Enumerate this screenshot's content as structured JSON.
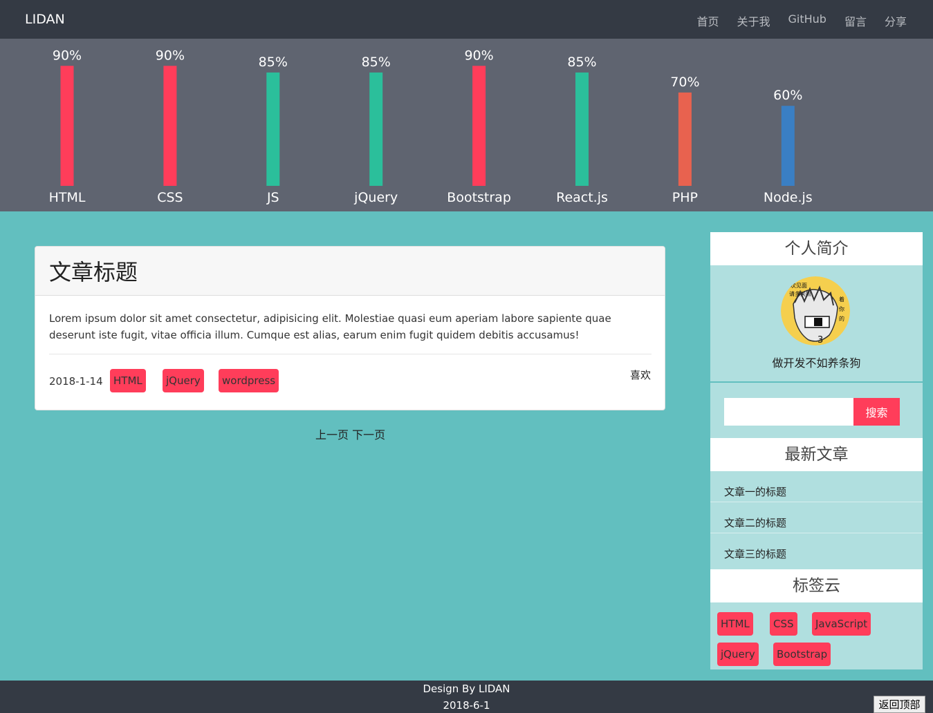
{
  "navbar": {
    "brand": "LIDAN",
    "links": [
      "首页",
      "关于我",
      "GitHub",
      "留言",
      "分享"
    ]
  },
  "colors": {
    "pink": "#ff3d5a",
    "green": "#2bbf9b",
    "orange": "#e8624f",
    "blue": "#3a7fc4",
    "teal_bg": "#62bfbf",
    "dark": "#343a44"
  },
  "chart_data": {
    "type": "bar",
    "categories": [
      "HTML",
      "CSS",
      "JS",
      "jQuery",
      "Bootstrap",
      "React.js",
      "PHP",
      "Node.js"
    ],
    "values": [
      90,
      90,
      85,
      85,
      90,
      85,
      70,
      60
    ],
    "labels": [
      "90%",
      "90%",
      "85%",
      "85%",
      "90%",
      "85%",
      "70%",
      "60%"
    ],
    "bar_colors": [
      "#ff3d5a",
      "#ff3d5a",
      "#2bbf9b",
      "#2bbf9b",
      "#ff3d5a",
      "#2bbf9b",
      "#e8624f",
      "#3a7fc4"
    ],
    "ylim": [
      0,
      100
    ],
    "grid": false,
    "title": "",
    "xlabel": "",
    "ylabel": ""
  },
  "article": {
    "title": "文章标题",
    "body": "Lorem ipsum dolor sit amet consectetur, adipisicing elit. Molestiae quasi eum aperiam labore sapiente quae deserunt iste fugit, vitae officia illum. Cumque est alias, earum enim fugit quidem debitis accusamus!",
    "date": "2018-1-14",
    "tags": [
      "HTML",
      "jQuery",
      "wordpress"
    ],
    "like": "喜欢"
  },
  "pager": {
    "prev": "上一页",
    "next": "下一页"
  },
  "sidebar": {
    "profile_title": "个人简介",
    "motto": "做开发不如养条狗",
    "search_button": "搜索",
    "search_value": "",
    "recent_title": "最新文章",
    "recent": [
      "文章一的标题",
      "文章二的标题",
      "文章三的标题"
    ],
    "tagcloud_title": "标签云",
    "tagcloud": [
      "HTML",
      "CSS",
      "JavaScript",
      "jQuery",
      "Bootstrap"
    ]
  },
  "footer": {
    "line1": "Design By LIDAN",
    "line2": "2018-6-1",
    "back_top": "返回顶部"
  }
}
